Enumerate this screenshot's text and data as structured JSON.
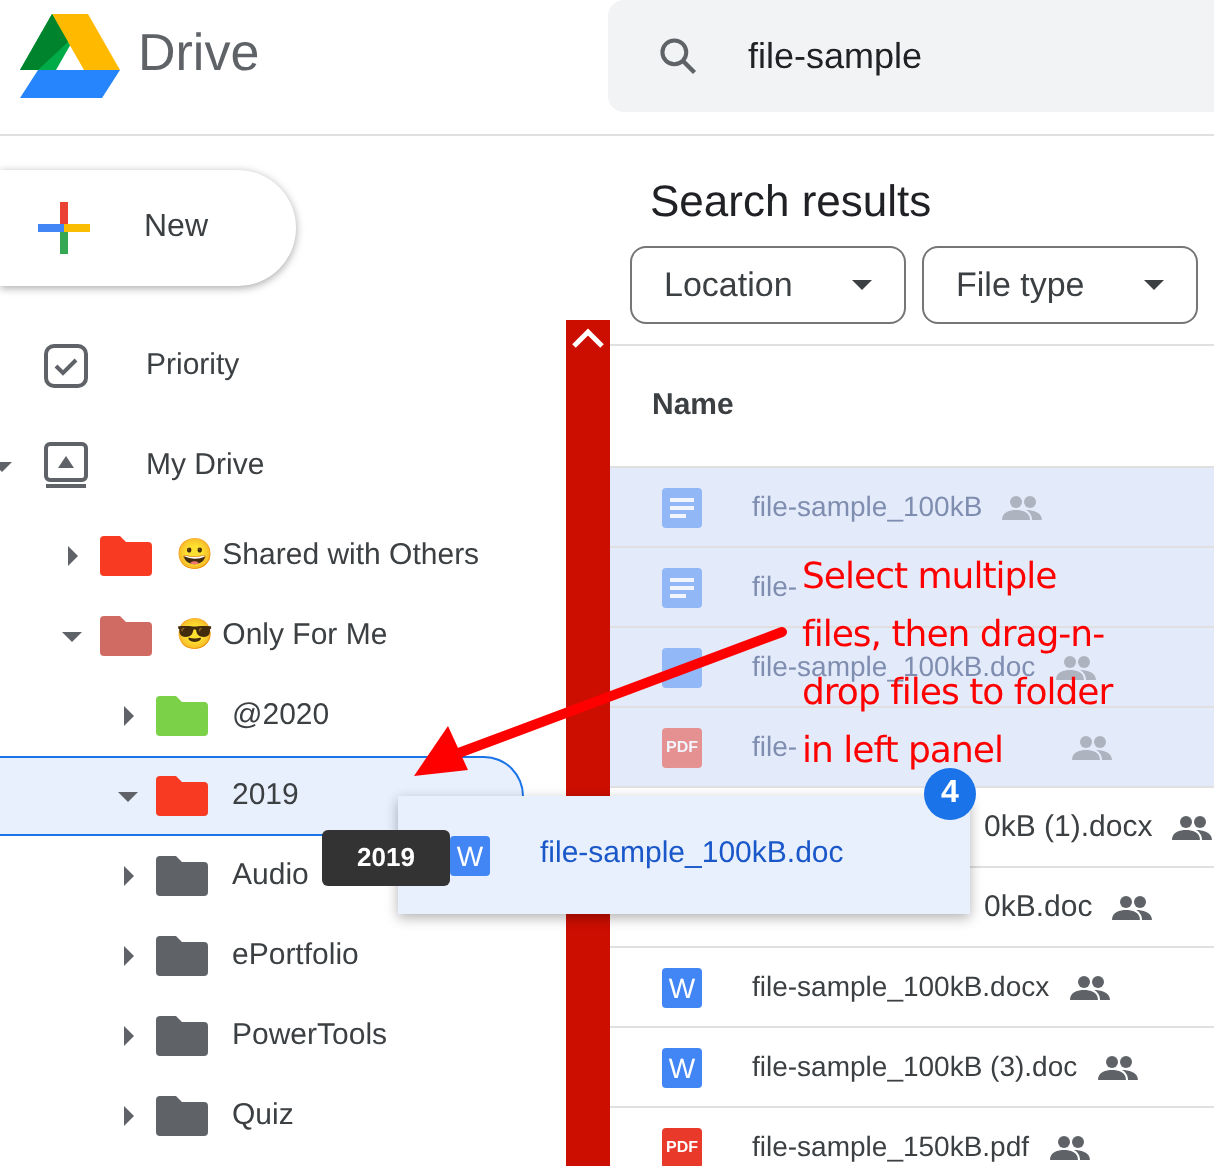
{
  "header": {
    "app_name": "Drive",
    "search": {
      "value": "file-sample"
    }
  },
  "new_button": {
    "label": "New"
  },
  "nav": [
    {
      "label": "Priority",
      "kind": "priority"
    },
    {
      "label": "My Drive",
      "kind": "drive",
      "expanded": true
    }
  ],
  "tree": [
    {
      "label": "😀 Shared with Others",
      "color": "#f83a22",
      "expanded": false,
      "selected": false
    },
    {
      "label": "😎 Only For Me",
      "color": "#d06b64",
      "expanded": true,
      "selected": false,
      "children": [
        {
          "label": "@2020",
          "color": "#7bd148",
          "expanded": false,
          "selected": false
        },
        {
          "label": "2019",
          "color": "#f83a22",
          "expanded": true,
          "selected": true
        },
        {
          "label": "Audio",
          "color": "#5f6368",
          "expanded": false,
          "selected": false
        },
        {
          "label": "ePortfolio",
          "color": "#5f6368",
          "expanded": false,
          "selected": false
        },
        {
          "label": "PowerTools",
          "color": "#5f6368",
          "expanded": false,
          "selected": false
        },
        {
          "label": "Quiz",
          "color": "#5f6368",
          "expanded": false,
          "selected": false
        }
      ]
    }
  ],
  "results": {
    "title": "Search results",
    "filters": [
      {
        "label": "Location"
      },
      {
        "label": "File type"
      }
    ],
    "columns": [
      "Name"
    ],
    "rows": [
      {
        "name": "file-sample_100kB",
        "kind": "doc",
        "dimmed": true,
        "covered": false,
        "shared": true
      },
      {
        "name": "file-",
        "kind": "doc",
        "dimmed": true,
        "covered": false,
        "shared": false
      },
      {
        "name": "file-sample_100kB.doc",
        "kind": "word",
        "dimmed": true,
        "covered": false,
        "shared": true
      },
      {
        "name": "file-",
        "kind": "pdf",
        "icon_text": "PDF",
        "dimmed": true,
        "covered": false,
        "shared": true,
        "name_cut": true
      },
      {
        "name": "0kB (1).docx",
        "dimmed": false,
        "covered": true,
        "shared": true
      },
      {
        "name": "0kB.doc",
        "dimmed": false,
        "covered": true,
        "shared": true
      },
      {
        "name": "file-sample_100kB.docx",
        "kind": "word",
        "icon_text": "W",
        "dimmed": false,
        "covered": false,
        "shared": true
      },
      {
        "name": "file-sample_100kB (3).doc",
        "kind": "word",
        "icon_text": "W",
        "dimmed": false,
        "covered": false,
        "shared": true
      },
      {
        "name": "file-sample_150kB.pdf",
        "kind": "pdf",
        "icon_text": "PDF",
        "dimmed": false,
        "covered": false,
        "shared": true
      }
    ]
  },
  "drag": {
    "file": "file-sample_100kB.doc",
    "icon_text": "W",
    "count": "4",
    "target_tooltip": "2019"
  },
  "annotation": {
    "lines": [
      "Select multiple",
      "files, then drag-n-",
      "drop files to folder",
      "in left panel"
    ]
  }
}
